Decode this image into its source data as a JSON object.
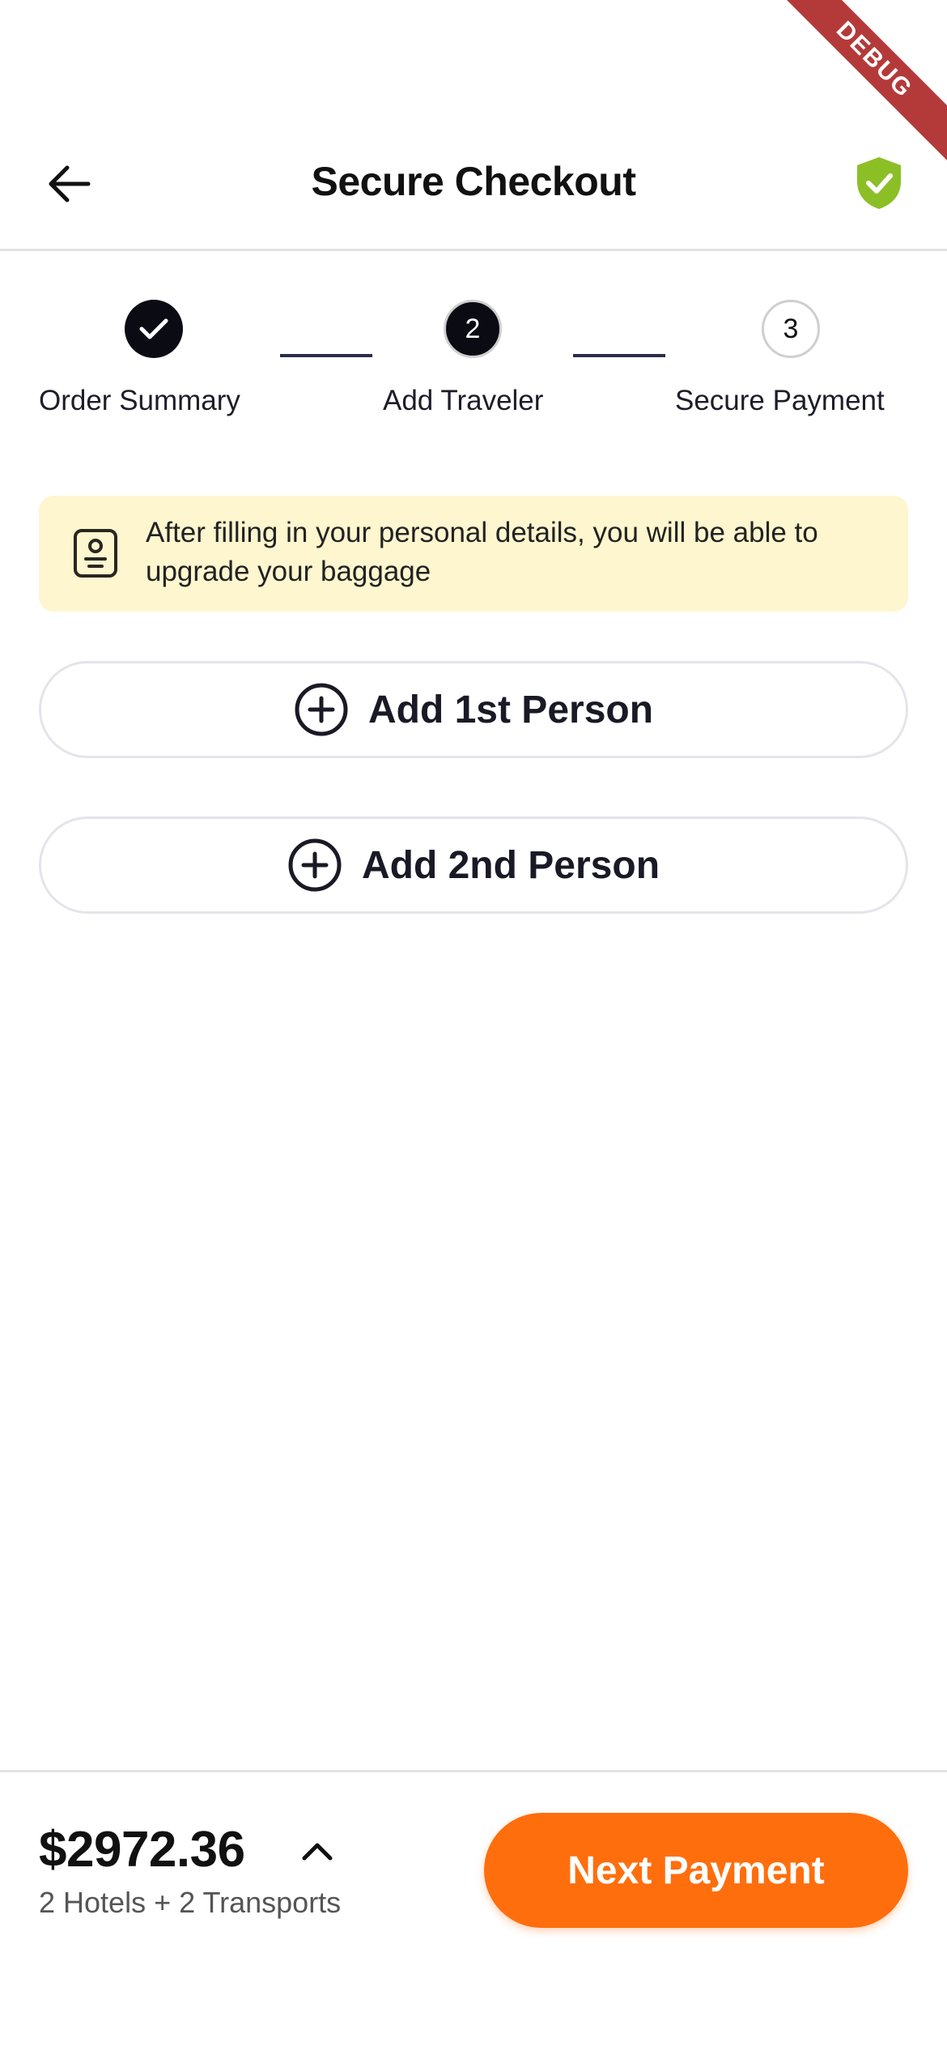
{
  "header": {
    "title": "Secure Checkout",
    "debug_banner": "DEBUG"
  },
  "stepper": {
    "steps": [
      {
        "label": "Order Summary",
        "state": "done",
        "number": ""
      },
      {
        "label": "Add Traveler",
        "state": "active",
        "number": "2"
      },
      {
        "label": "Secure Payment",
        "state": "todo",
        "number": "3"
      }
    ]
  },
  "notice": {
    "text": "After filling in your personal details, you will be able to upgrade your baggage"
  },
  "travelers": {
    "add_first": "Add 1st Person",
    "add_second": "Add 2nd Person"
  },
  "footer": {
    "total": "$2972.36",
    "summary": "2 Hotels + 2 Transports",
    "next_label": "Next Payment"
  },
  "colors": {
    "accent": "#ff6e0d",
    "shield": "#8cbf26",
    "notice_bg": "#fdf6cf",
    "step_dark": "#0b0b14"
  },
  "icons": {
    "back": "arrow-left-icon",
    "shield": "shield-check-icon",
    "notice": "id-card-icon",
    "add": "plus-circle-icon",
    "expand": "chevron-up-icon",
    "done": "check-icon"
  }
}
